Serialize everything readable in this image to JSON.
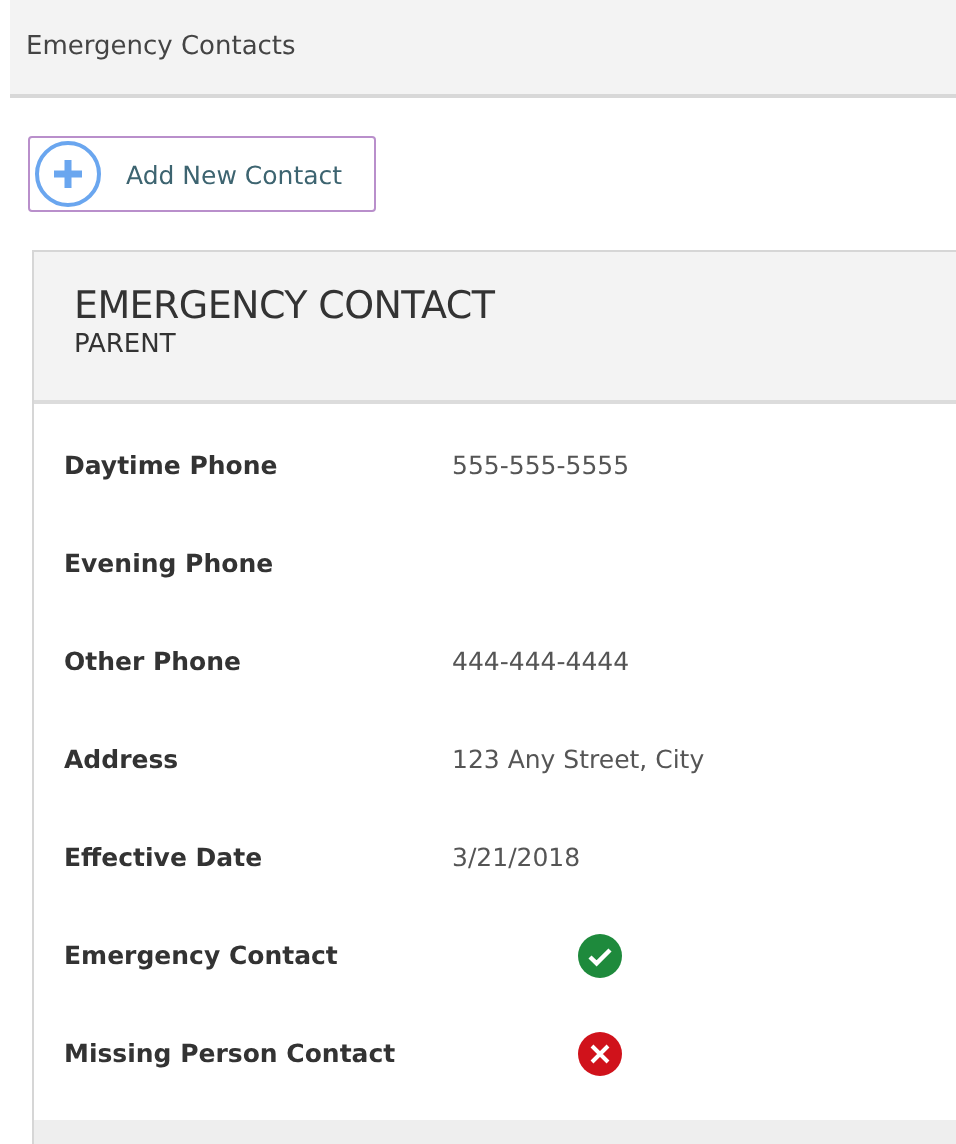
{
  "page_title": "Emergency Contacts",
  "add_button": {
    "label": "Add New Contact"
  },
  "card": {
    "title": "EMERGENCY CONTACT",
    "subtitle": "PARENT",
    "rows": [
      {
        "kind": "text",
        "label": "Daytime Phone",
        "value": "555-555-5555"
      },
      {
        "kind": "text",
        "label": "Evening Phone"
      },
      {
        "kind": "text",
        "label": "Other Phone",
        "value": "444-444-4444"
      },
      {
        "kind": "text",
        "label": "Address",
        "value": "123 Any Street, City"
      },
      {
        "kind": "text",
        "label": "Effective Date",
        "value": "3/21/2018"
      },
      {
        "kind": "flag",
        "label": "Emergency Contact",
        "on": true
      },
      {
        "kind": "flag",
        "label": "Missing Person Contact",
        "on": false
      }
    ]
  }
}
